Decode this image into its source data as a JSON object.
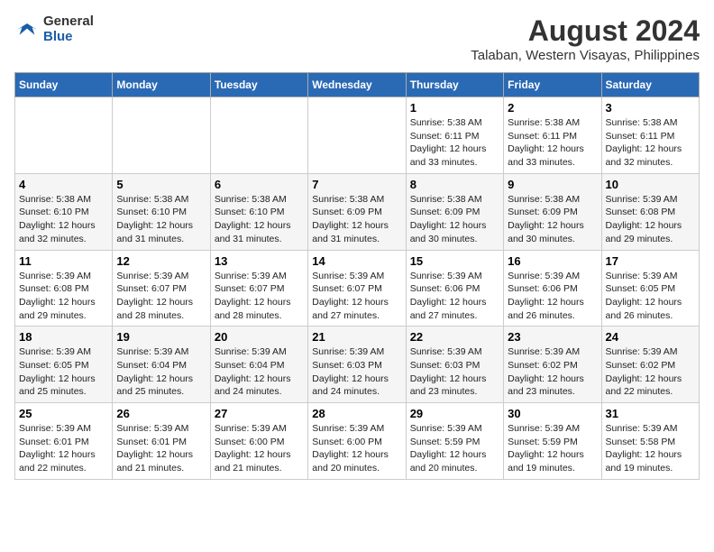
{
  "logo": {
    "general": "General",
    "blue": "Blue"
  },
  "title": "August 2024",
  "subtitle": "Talaban, Western Visayas, Philippines",
  "days": [
    "Sunday",
    "Monday",
    "Tuesday",
    "Wednesday",
    "Thursday",
    "Friday",
    "Saturday"
  ],
  "weeks": [
    [
      {
        "date": "",
        "info": ""
      },
      {
        "date": "",
        "info": ""
      },
      {
        "date": "",
        "info": ""
      },
      {
        "date": "",
        "info": ""
      },
      {
        "date": "1",
        "info": "Sunrise: 5:38 AM\nSunset: 6:11 PM\nDaylight: 12 hours\nand 33 minutes."
      },
      {
        "date": "2",
        "info": "Sunrise: 5:38 AM\nSunset: 6:11 PM\nDaylight: 12 hours\nand 33 minutes."
      },
      {
        "date": "3",
        "info": "Sunrise: 5:38 AM\nSunset: 6:11 PM\nDaylight: 12 hours\nand 32 minutes."
      }
    ],
    [
      {
        "date": "4",
        "info": "Sunrise: 5:38 AM\nSunset: 6:10 PM\nDaylight: 12 hours\nand 32 minutes."
      },
      {
        "date": "5",
        "info": "Sunrise: 5:38 AM\nSunset: 6:10 PM\nDaylight: 12 hours\nand 31 minutes."
      },
      {
        "date": "6",
        "info": "Sunrise: 5:38 AM\nSunset: 6:10 PM\nDaylight: 12 hours\nand 31 minutes."
      },
      {
        "date": "7",
        "info": "Sunrise: 5:38 AM\nSunset: 6:09 PM\nDaylight: 12 hours\nand 31 minutes."
      },
      {
        "date": "8",
        "info": "Sunrise: 5:38 AM\nSunset: 6:09 PM\nDaylight: 12 hours\nand 30 minutes."
      },
      {
        "date": "9",
        "info": "Sunrise: 5:38 AM\nSunset: 6:09 PM\nDaylight: 12 hours\nand 30 minutes."
      },
      {
        "date": "10",
        "info": "Sunrise: 5:39 AM\nSunset: 6:08 PM\nDaylight: 12 hours\nand 29 minutes."
      }
    ],
    [
      {
        "date": "11",
        "info": "Sunrise: 5:39 AM\nSunset: 6:08 PM\nDaylight: 12 hours\nand 29 minutes."
      },
      {
        "date": "12",
        "info": "Sunrise: 5:39 AM\nSunset: 6:07 PM\nDaylight: 12 hours\nand 28 minutes."
      },
      {
        "date": "13",
        "info": "Sunrise: 5:39 AM\nSunset: 6:07 PM\nDaylight: 12 hours\nand 28 minutes."
      },
      {
        "date": "14",
        "info": "Sunrise: 5:39 AM\nSunset: 6:07 PM\nDaylight: 12 hours\nand 27 minutes."
      },
      {
        "date": "15",
        "info": "Sunrise: 5:39 AM\nSunset: 6:06 PM\nDaylight: 12 hours\nand 27 minutes."
      },
      {
        "date": "16",
        "info": "Sunrise: 5:39 AM\nSunset: 6:06 PM\nDaylight: 12 hours\nand 26 minutes."
      },
      {
        "date": "17",
        "info": "Sunrise: 5:39 AM\nSunset: 6:05 PM\nDaylight: 12 hours\nand 26 minutes."
      }
    ],
    [
      {
        "date": "18",
        "info": "Sunrise: 5:39 AM\nSunset: 6:05 PM\nDaylight: 12 hours\nand 25 minutes."
      },
      {
        "date": "19",
        "info": "Sunrise: 5:39 AM\nSunset: 6:04 PM\nDaylight: 12 hours\nand 25 minutes."
      },
      {
        "date": "20",
        "info": "Sunrise: 5:39 AM\nSunset: 6:04 PM\nDaylight: 12 hours\nand 24 minutes."
      },
      {
        "date": "21",
        "info": "Sunrise: 5:39 AM\nSunset: 6:03 PM\nDaylight: 12 hours\nand 24 minutes."
      },
      {
        "date": "22",
        "info": "Sunrise: 5:39 AM\nSunset: 6:03 PM\nDaylight: 12 hours\nand 23 minutes."
      },
      {
        "date": "23",
        "info": "Sunrise: 5:39 AM\nSunset: 6:02 PM\nDaylight: 12 hours\nand 23 minutes."
      },
      {
        "date": "24",
        "info": "Sunrise: 5:39 AM\nSunset: 6:02 PM\nDaylight: 12 hours\nand 22 minutes."
      }
    ],
    [
      {
        "date": "25",
        "info": "Sunrise: 5:39 AM\nSunset: 6:01 PM\nDaylight: 12 hours\nand 22 minutes."
      },
      {
        "date": "26",
        "info": "Sunrise: 5:39 AM\nSunset: 6:01 PM\nDaylight: 12 hours\nand 21 minutes."
      },
      {
        "date": "27",
        "info": "Sunrise: 5:39 AM\nSunset: 6:00 PM\nDaylight: 12 hours\nand 21 minutes."
      },
      {
        "date": "28",
        "info": "Sunrise: 5:39 AM\nSunset: 6:00 PM\nDaylight: 12 hours\nand 20 minutes."
      },
      {
        "date": "29",
        "info": "Sunrise: 5:39 AM\nSunset: 5:59 PM\nDaylight: 12 hours\nand 20 minutes."
      },
      {
        "date": "30",
        "info": "Sunrise: 5:39 AM\nSunset: 5:59 PM\nDaylight: 12 hours\nand 19 minutes."
      },
      {
        "date": "31",
        "info": "Sunrise: 5:39 AM\nSunset: 5:58 PM\nDaylight: 12 hours\nand 19 minutes."
      }
    ]
  ]
}
